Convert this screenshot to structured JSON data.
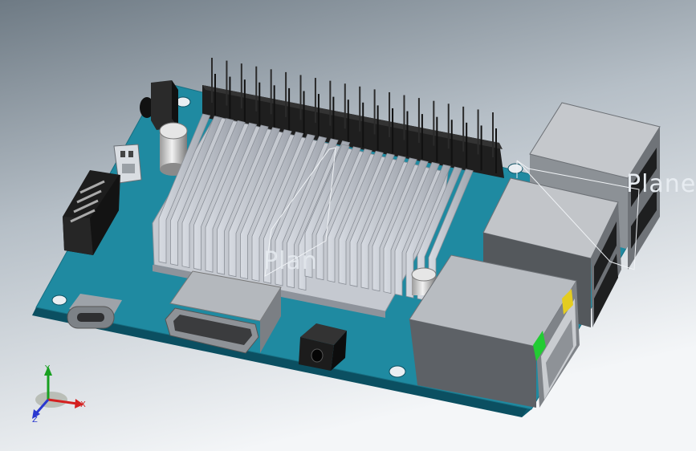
{
  "scene": {
    "plane_labels": [
      {
        "id": "right",
        "text": "Plane"
      },
      {
        "id": "center",
        "text": "Plan"
      }
    ],
    "triad": {
      "x_label": "X",
      "y_label": "Y",
      "z_label": "Z"
    }
  },
  "colors": {
    "background_top": "#6e7a84",
    "background_bottom": "#f4f6f8",
    "pcb_top": "#1f8aa1",
    "pcb_edge": "#0b4f61",
    "heatsink": "#b9bdc6",
    "metal_dark": "#565b60",
    "connector_black": "#1d1d1d",
    "led_green": "#22cc33",
    "led_yellow": "#e4cc20",
    "axis_x": "#d42020",
    "axis_y": "#18a020",
    "axis_z": "#2a38d0"
  }
}
